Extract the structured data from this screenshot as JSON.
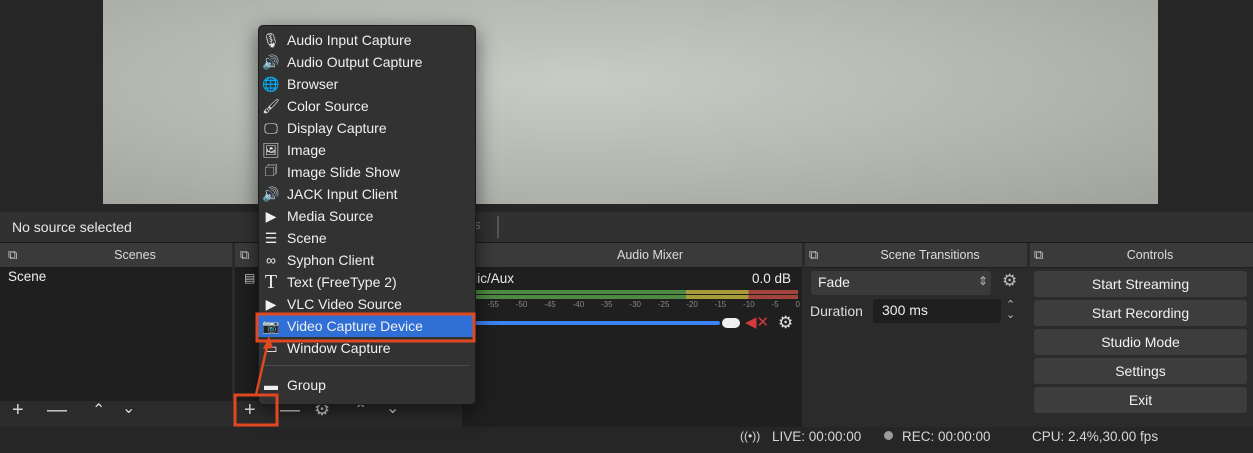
{
  "status": {
    "no_source": "No source selected",
    "filters_tab": "rs",
    "live": "LIVE: 00:00:00",
    "rec": "REC: 00:00:00",
    "cpu": "CPU: 2.4%,30.00 fps"
  },
  "scenes": {
    "title": "Scenes",
    "items": [
      "Scene"
    ]
  },
  "audio_mixer": {
    "title": "Audio Mixer",
    "channel": "Mic/Aux",
    "level": "0.0 dB",
    "volume_fraction": 1.0,
    "ticks": [
      "0",
      "-55",
      "-50",
      "-45",
      "-40",
      "-35",
      "-30",
      "-25",
      "-20",
      "-15",
      "-10",
      "-5",
      "0"
    ]
  },
  "transitions": {
    "title": "Scene Transitions",
    "selected": "Fade",
    "duration_label": "Duration",
    "duration_value": "300 ms"
  },
  "controls": {
    "title": "Controls",
    "buttons": [
      "Start Streaming",
      "Start Recording",
      "Studio Mode",
      "Settings",
      "Exit"
    ]
  },
  "add_source_menu": {
    "items": [
      {
        "label": "Audio Input Capture",
        "icon": "microphone-icon"
      },
      {
        "label": "Audio Output Capture",
        "icon": "speaker-icon"
      },
      {
        "label": "Browser",
        "icon": "globe-icon"
      },
      {
        "label": "Color Source",
        "icon": "paintbrush-icon"
      },
      {
        "label": "Display Capture",
        "icon": "monitor-icon"
      },
      {
        "label": "Image",
        "icon": "image-icon"
      },
      {
        "label": "Image Slide Show",
        "icon": "slideshow-icon"
      },
      {
        "label": "JACK Input Client",
        "icon": "speaker-icon"
      },
      {
        "label": "Media Source",
        "icon": "play-icon"
      },
      {
        "label": "Scene",
        "icon": "list-icon"
      },
      {
        "label": "Syphon Client",
        "icon": "syphon-icon"
      },
      {
        "label": "Text (FreeType 2)",
        "icon": "text-icon"
      },
      {
        "label": "VLC Video Source",
        "icon": "play-icon"
      },
      {
        "label": "Video Capture Device",
        "icon": "camera-icon"
      },
      {
        "label": "Window Capture",
        "icon": "window-icon"
      },
      {
        "label": "Group",
        "icon": "folder-icon"
      }
    ],
    "selected": "Video Capture Device"
  },
  "colors": {
    "highlight": "#2f6fd6",
    "annotation": "#e0481f",
    "meter_green": "#5aa84a",
    "meter_yellow": "#c9b23b",
    "meter_red": "#c0443b",
    "mute_red": "#d43a3a"
  }
}
